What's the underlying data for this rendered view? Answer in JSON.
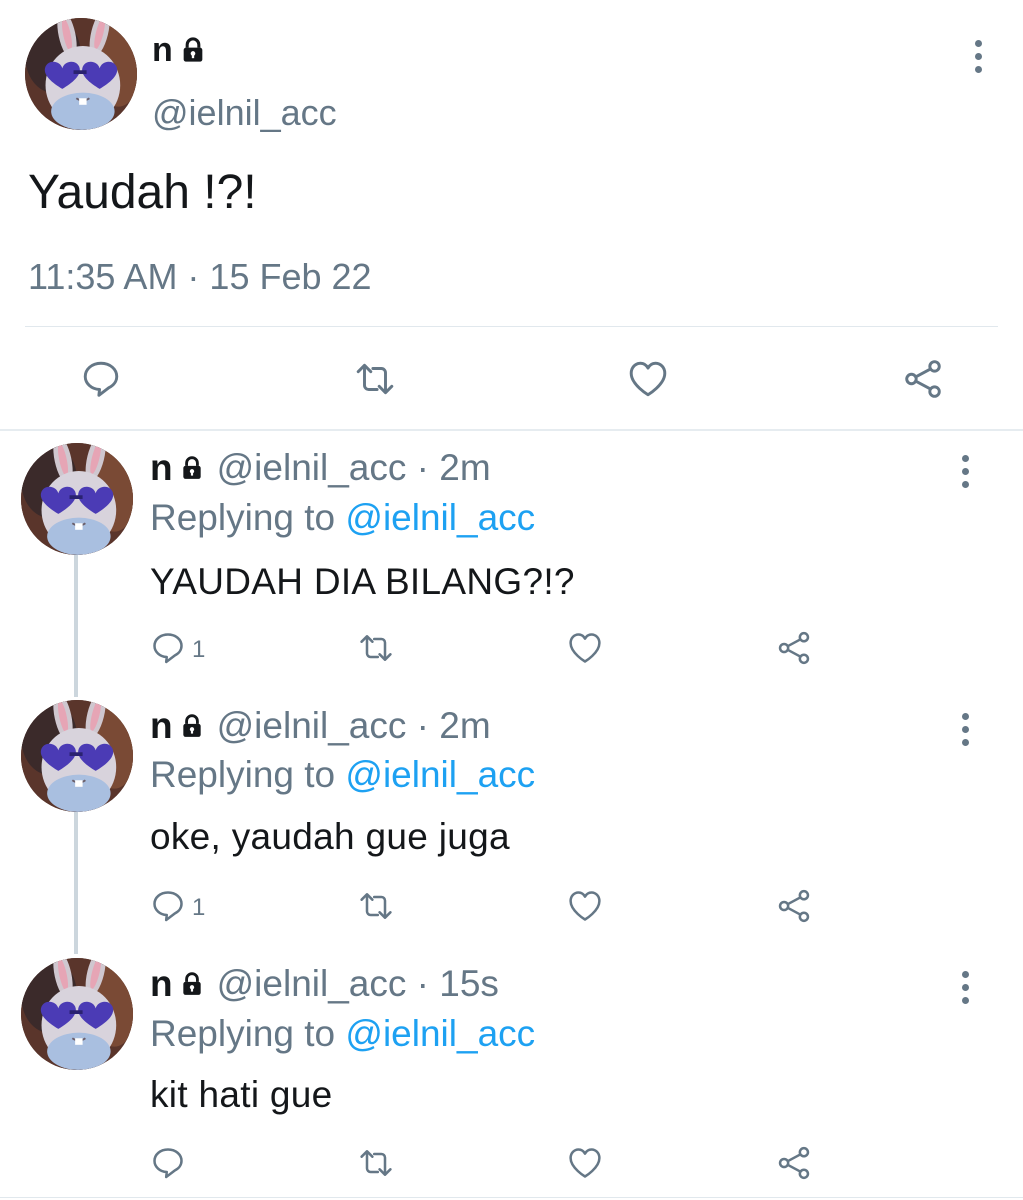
{
  "main_tweet": {
    "name": "n",
    "handle": "@ielnil_acc",
    "text": "Yaudah !?!",
    "timestamp": "11:35 AM · 15 Feb 22",
    "actions": [
      "reply-icon",
      "retweet-icon",
      "like-icon",
      "share-icon"
    ]
  },
  "replies": [
    {
      "name": "n",
      "handle_time": "@ielnil_acc · 2m",
      "replying_prefix": "Replying to ",
      "replying_to": "@ielnil_acc",
      "text": "YAUDAH DIA BILANG?!?",
      "reply_count": "1"
    },
    {
      "name": "n",
      "handle_time": "@ielnil_acc · 2m",
      "replying_prefix": "Replying to ",
      "replying_to": "@ielnil_acc",
      "text": "oke, yaudah gue juga",
      "reply_count": "1"
    },
    {
      "name": "n",
      "handle_time": "@ielnil_acc · 15s",
      "replying_prefix": "Replying to ",
      "replying_to": "@ielnil_acc",
      "text": "kit hati gue",
      "reply_count": ""
    }
  ],
  "colors": {
    "text": "#14171a",
    "secondary": "#657786",
    "link": "#1da1f2",
    "divider": "#e1e8ed",
    "thread_line": "#ccd6dd"
  }
}
